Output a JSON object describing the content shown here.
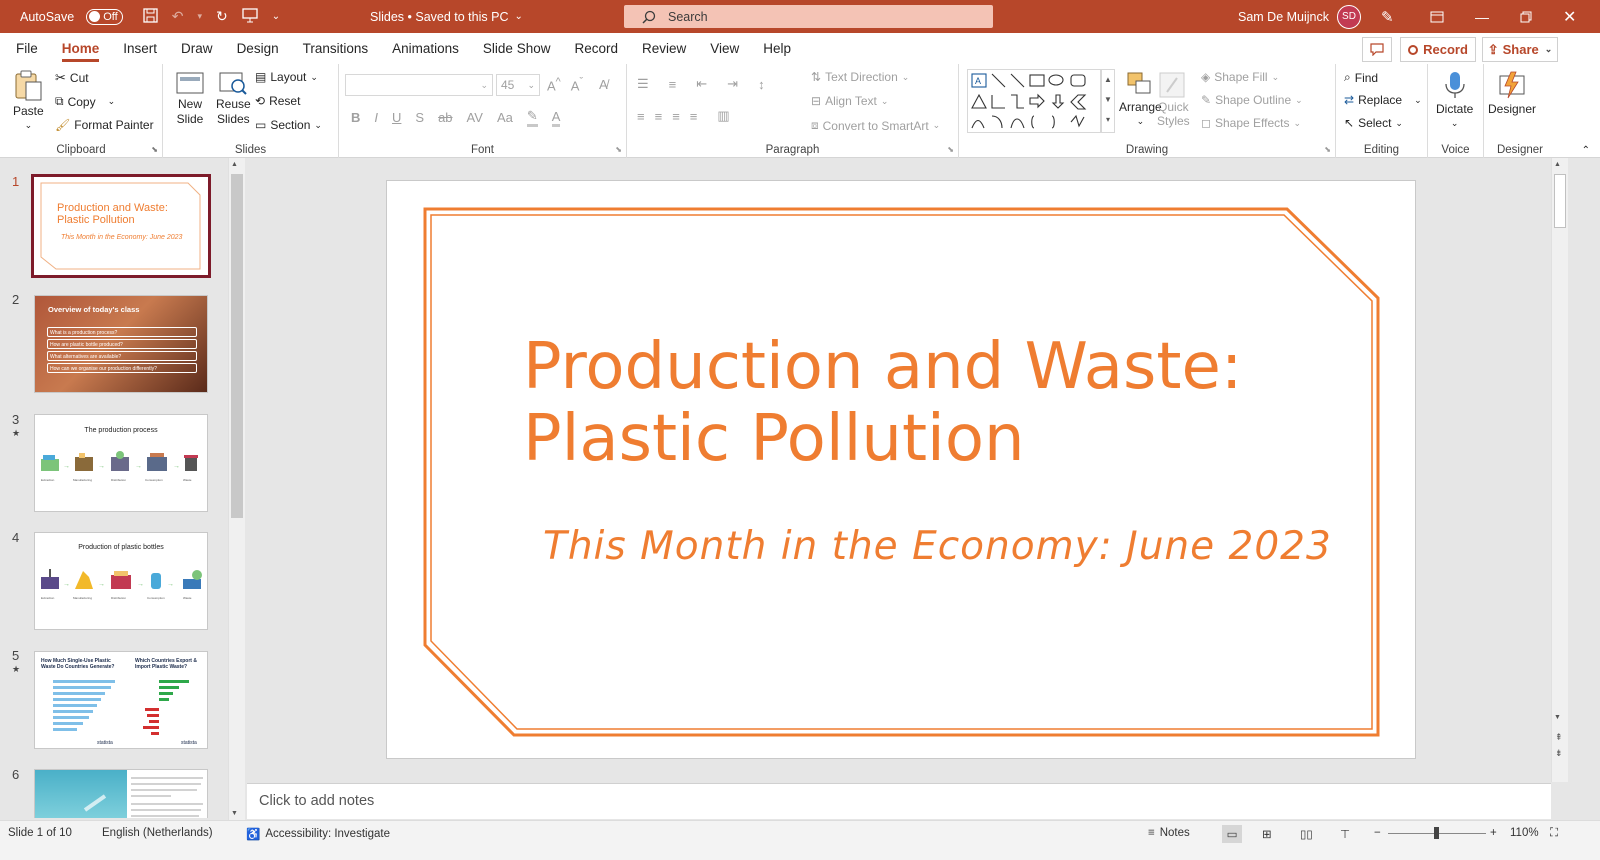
{
  "titlebar": {
    "autosave_label": "AutoSave",
    "autosave_state": "Off",
    "doc_title": "Slides • Saved to this PC",
    "search_placeholder": "Search",
    "user_name": "Sam De Muijnck",
    "user_initials": "SD"
  },
  "menu": [
    "File",
    "Home",
    "Insert",
    "Draw",
    "Design",
    "Transitions",
    "Animations",
    "Slide Show",
    "Record",
    "Review",
    "View",
    "Help"
  ],
  "menu_active": "Home",
  "actions": {
    "record": "Record",
    "share": "Share"
  },
  "ribbon": {
    "clipboard": {
      "label": "Clipboard",
      "paste": "Paste",
      "cut": "Cut",
      "copy": "Copy",
      "format_painter": "Format Painter"
    },
    "slides": {
      "label": "Slides",
      "new_slide_1": "New",
      "new_slide_2": "Slide",
      "reuse_1": "Reuse",
      "reuse_2": "Slides",
      "layout": "Layout",
      "reset": "Reset",
      "section": "Section"
    },
    "font": {
      "label": "Font",
      "size": "45"
    },
    "paragraph": {
      "label": "Paragraph",
      "text_direction": "Text Direction",
      "align_text": "Align Text",
      "convert_smartart": "Convert to SmartArt"
    },
    "drawing": {
      "label": "Drawing",
      "arrange": "Arrange",
      "quick_1": "Quick",
      "quick_2": "Styles",
      "shape_fill": "Shape Fill",
      "shape_outline": "Shape Outline",
      "shape_effects": "Shape Effects"
    },
    "editing": {
      "label": "Editing",
      "find": "Find",
      "replace": "Replace",
      "select": "Select"
    },
    "voice": {
      "label": "Voice",
      "dictate": "Dictate"
    },
    "designer": {
      "label": "Designer",
      "designer": "Designer"
    }
  },
  "thumbnails": [
    {
      "num": "1",
      "title": "Production and Waste: Plastic Pollution",
      "subtitle": "This Month in the Economy: June 2023"
    },
    {
      "num": "2",
      "title": "Overview of today's class",
      "items": [
        "What is a production process?",
        "How are plastic bottle produced?",
        "What alternatives are available?",
        "How can we organise our production differently?"
      ]
    },
    {
      "num": "3",
      "title": "The production process",
      "star": "★"
    },
    {
      "num": "4",
      "title": "Production of plastic bottles"
    },
    {
      "num": "5",
      "left_title": "How Much Single-Use Plastic Waste Do Countries Generate?",
      "right_title": "Which Countries Export & Import Plastic Waste?",
      "star": "★"
    },
    {
      "num": "6"
    }
  ],
  "slide": {
    "title_line1": "Production and Waste:",
    "title_line2": "Plastic Pollution",
    "subtitle": "This Month in the Economy: June 2023"
  },
  "notes_placeholder": "Click to add notes",
  "status": {
    "slide_info": "Slide 1 of 10",
    "language": "English (Netherlands)",
    "accessibility": "Accessibility: Investigate",
    "notes": "Notes",
    "zoom": "110%"
  },
  "colors": {
    "accent": "#b7472a",
    "slide_orange": "#ef7d31",
    "selected_border": "#7d1b2a"
  }
}
